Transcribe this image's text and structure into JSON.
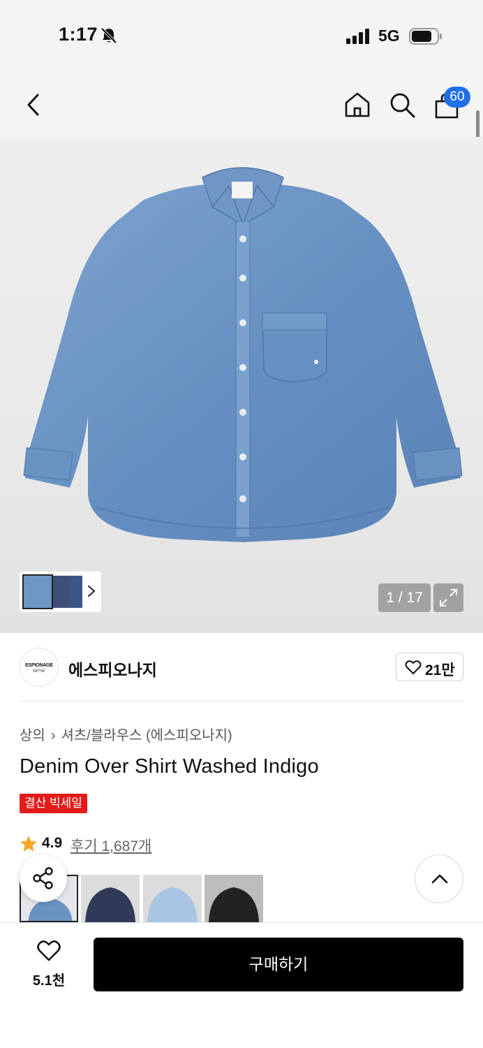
{
  "status_bar": {
    "time": "1:17",
    "network": "5G"
  },
  "nav": {
    "cart_count": "60",
    "icons": [
      "back-icon",
      "home-icon",
      "search-icon",
      "cart-icon"
    ]
  },
  "gallery": {
    "counter": "1 / 17",
    "main_color": "#6a93c4"
  },
  "brand": {
    "logo_line1": "ESPIONAGE",
    "logo_line2": "N37°56'",
    "name": "에스피오나지",
    "likes": "21만"
  },
  "breadcrumb": {
    "category": "상의",
    "subcategory": "셔츠/블라우스 (에스피오나지)"
  },
  "product": {
    "title": "Denim Over Shirt Washed Indigo",
    "tag": "결산 빅세일",
    "rating": "4.9",
    "reviews": "후기 1,687개"
  },
  "colors": {
    "accent_red": "#e31b1b",
    "badge_blue": "#1f6fe6",
    "swatches": [
      "#6a93c4",
      "#2e3a58",
      "#a8c6e4",
      "#222222"
    ]
  },
  "bottom_bar": {
    "wish_count": "5.1천",
    "buy_label": "구매하기"
  }
}
